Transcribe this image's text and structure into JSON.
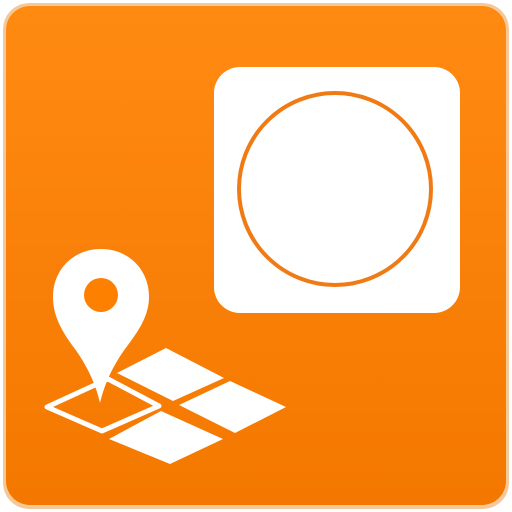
{
  "app_icon": {
    "icon_name": "location-circle-app-icon",
    "colors": {
      "background": "#fd8000",
      "background_top": "#ff8a12",
      "background_bottom": "#f47800",
      "rim": "#f5c89a",
      "foreground": "#ffffff",
      "ring": "#f07a14"
    },
    "elements": [
      {
        "name": "rounded-square-icon",
        "role": "white rounded square with circle"
      },
      {
        "name": "map-pin-icon",
        "role": "location marker"
      },
      {
        "name": "map-grid-icon",
        "role": "isometric map tiles"
      }
    ]
  }
}
